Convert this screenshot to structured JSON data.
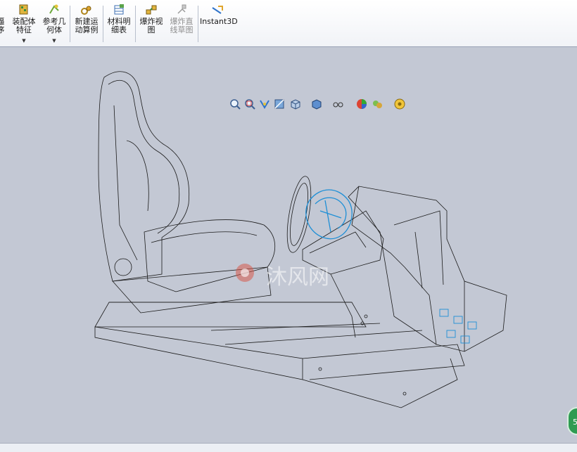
{
  "toolbar": {
    "items": [
      {
        "label": "逼\n序",
        "icon": "partial-icon"
      },
      {
        "label": "装配体\n特征",
        "icon": "assembly-features-icon",
        "dropdown": true
      },
      {
        "label": "参考几\n何体",
        "icon": "reference-geometry-icon",
        "dropdown": true
      },
      {
        "label": "新建运\n动算例",
        "icon": "motion-study-icon"
      },
      {
        "label": "材料明\n细表",
        "icon": "bom-icon"
      },
      {
        "label": "爆炸视\n图",
        "icon": "exploded-view-icon"
      },
      {
        "label": "爆炸直\n线草图",
        "icon": "explode-line-sketch-icon",
        "disabled": true
      },
      {
        "label": "Instant3D",
        "icon": "instant3d-icon"
      }
    ]
  },
  "view_toolbar": {
    "icons": [
      "zoom-to-fit-icon",
      "zoom-to-area-icon",
      "previous-view-icon",
      "section-view-icon",
      "view-orientation-icon",
      "display-style-icon",
      "hide-show-items-icon",
      "edit-appearance-icon",
      "apply-scene-icon",
      "view-settings-icon"
    ]
  },
  "watermark": {
    "text": "沐风网"
  },
  "side_badge": {
    "text": "5"
  },
  "colors": {
    "accent": "#3a8fd9",
    "wire": "#1a1a1a",
    "selected": "#1e8fd6",
    "background": "#c3c8d4"
  }
}
